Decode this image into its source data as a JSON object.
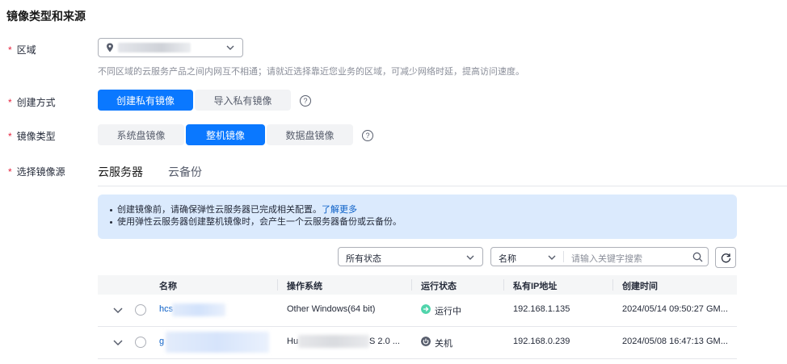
{
  "section_title": "镜像类型和来源",
  "required_mark": "*",
  "region": {
    "label": "区域",
    "hint": "不同区域的云服务产品之间内网互不相通；请就近选择靠近您业务的区域，可减少网络时延，提高访问速度。"
  },
  "create_method": {
    "label": "创建方式",
    "options": [
      "创建私有镜像",
      "导入私有镜像"
    ],
    "selected": "创建私有镜像",
    "help": "?"
  },
  "image_type": {
    "label": "镜像类型",
    "options": [
      "系统盘镜像",
      "整机镜像",
      "数据盘镜像"
    ],
    "selected": "整机镜像",
    "help": "?"
  },
  "image_source": {
    "label": "选择镜像源",
    "tabs": [
      "云服务器",
      "云备份"
    ],
    "active_tab": "云服务器"
  },
  "alert": {
    "line1_text": "创建镜像前，请确保弹性云服务器已完成相关配置。",
    "line1_link": "了解更多",
    "line2_text": "使用弹性云服务器创建整机镜像时，会产生一个云服务器备份或云备份。"
  },
  "filters": {
    "status_value": "所有状态",
    "field_value": "名称",
    "search_placeholder": "请输入关键字搜索"
  },
  "table": {
    "columns": [
      "名称",
      "操作系统",
      "运行状态",
      "私有IP地址",
      "创建时间"
    ],
    "rows": [
      {
        "name": "hcs",
        "os": "Other Windows(64 bit)",
        "status": "运行中",
        "status_color": "#50d4ab",
        "ip": "192.168.1.135",
        "created": "2024/05/14 09:50:27 GM..."
      },
      {
        "name": "g",
        "os_prefix": "Hu",
        "os_suffix": "S 2.0 ...",
        "status": "关机",
        "status_color": "#575d6c",
        "ip": "192.168.0.239",
        "created": "2024/05/08 16:47:13 GM..."
      }
    ]
  },
  "colors": {
    "primary": "#0a78ff",
    "link": "#0a5fc7",
    "required": "#e6233e",
    "alert_bg": "#dbeafd"
  }
}
